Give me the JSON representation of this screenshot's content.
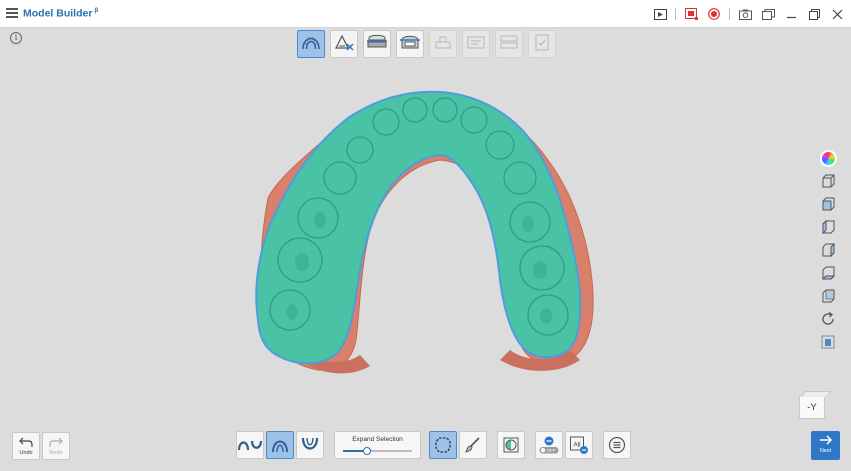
{
  "app": {
    "title": "Model Builder",
    "version_mark": "β"
  },
  "info_icon": "i",
  "step_toolbar": [
    {
      "name": "arch-trim-step",
      "icon": "arch-icon",
      "state": "active"
    },
    {
      "name": "base-step",
      "icon": "base-icon",
      "state": "normal"
    },
    {
      "name": "model-base-step",
      "icon": "model-base-icon",
      "state": "normal"
    },
    {
      "name": "hollow-step",
      "icon": "hollow-icon",
      "state": "normal"
    },
    {
      "name": "die-step",
      "icon": "die-icon",
      "state": "disabled"
    },
    {
      "name": "label-step",
      "icon": "label-icon",
      "state": "disabled"
    },
    {
      "name": "articulator-step",
      "icon": "articulator-icon",
      "state": "disabled"
    },
    {
      "name": "complete-step",
      "icon": "clipboard-check-icon",
      "state": "disabled"
    }
  ],
  "view_toolbar": [
    "color-wheel-icon",
    "view-top-icon",
    "view-front-icon",
    "view-left-icon",
    "view-right-icon",
    "view-bottom-icon",
    "view-back-icon",
    "reset-view-icon",
    "view-mode-icon"
  ],
  "axis": {
    "label": "-Y"
  },
  "undo": {
    "label": "Undo"
  },
  "redo": {
    "label": "Redo"
  },
  "bottom_toolbar": {
    "expand_label": "Expand Selection",
    "expand_value": 0.35,
    "all_label": "All",
    "off_label": "OFF"
  },
  "next": {
    "label": "Next"
  },
  "colors": {
    "accent": "#2f78c8",
    "active_bg": "#9cc2ea",
    "teal": "#49c2a6",
    "gum": "#d9806b"
  }
}
